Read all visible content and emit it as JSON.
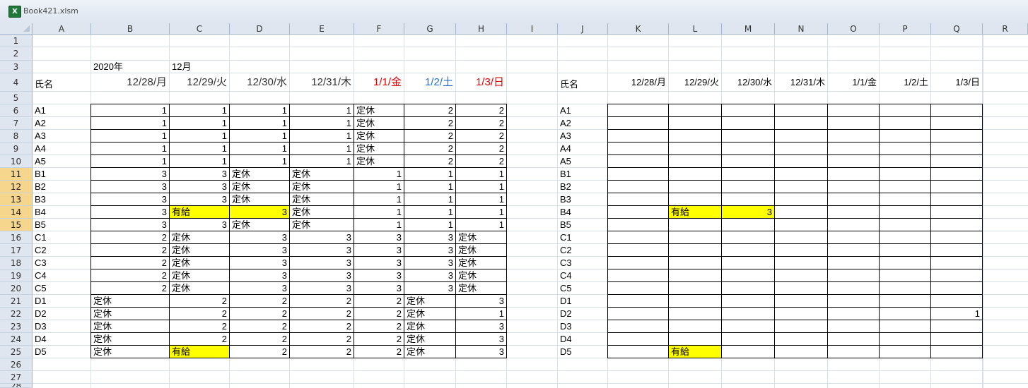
{
  "window": {
    "title": "Book421.xlsm",
    "icon": "excel-file-icon"
  },
  "columns": [
    "A",
    "B",
    "C",
    "D",
    "E",
    "F",
    "G",
    "H",
    "I",
    "J",
    "K",
    "L",
    "M",
    "N",
    "O",
    "P",
    "Q",
    "R"
  ],
  "rows": [
    "1",
    "2",
    "3",
    "4",
    "5",
    "6",
    "7",
    "8",
    "9",
    "10",
    "11",
    "12",
    "13",
    "14",
    "15",
    "16",
    "17",
    "18",
    "19",
    "20",
    "21",
    "22",
    "23",
    "24",
    "25",
    "26",
    "27",
    "28"
  ],
  "selected_row_headers": [
    "11",
    "12",
    "13",
    "14",
    "15"
  ],
  "header": {
    "year": "2020年",
    "month": "12月",
    "name_label": "氏名",
    "dates": [
      "12/28/月",
      "12/29/火",
      "12/30/水",
      "12/31/木",
      "1/1/金",
      "1/2/土",
      "1/3/日"
    ],
    "date_colors": [
      "#333333",
      "#333333",
      "#333333",
      "#333333",
      "#e00000",
      "#1e6fd0",
      "#e00000"
    ]
  },
  "left_table": [
    {
      "name": "A1",
      "cells": [
        "1",
        "1",
        "1",
        "1",
        "定休",
        "2",
        "2"
      ]
    },
    {
      "name": "A2",
      "cells": [
        "1",
        "1",
        "1",
        "1",
        "定休",
        "2",
        "2"
      ]
    },
    {
      "name": "A3",
      "cells": [
        "1",
        "1",
        "1",
        "1",
        "定休",
        "2",
        "2"
      ]
    },
    {
      "name": "A4",
      "cells": [
        "1",
        "1",
        "1",
        "1",
        "定休",
        "2",
        "2"
      ]
    },
    {
      "name": "A5",
      "cells": [
        "1",
        "1",
        "1",
        "1",
        "定休",
        "2",
        "2"
      ]
    },
    {
      "name": "B1",
      "cells": [
        "3",
        "3",
        "定休",
        "定休",
        "1",
        "1",
        "1"
      ]
    },
    {
      "name": "B2",
      "cells": [
        "3",
        "3",
        "定休",
        "定休",
        "1",
        "1",
        "1"
      ]
    },
    {
      "name": "B3",
      "cells": [
        "3",
        "3",
        "定休",
        "定休",
        "1",
        "1",
        "1"
      ]
    },
    {
      "name": "B4",
      "cells": [
        "3",
        "有給",
        "3",
        "定休",
        "1",
        "1",
        "1"
      ]
    },
    {
      "name": "B5",
      "cells": [
        "3",
        "3",
        "定休",
        "定休",
        "1",
        "1",
        "1"
      ]
    },
    {
      "name": "C1",
      "cells": [
        "2",
        "定休",
        "3",
        "3",
        "3",
        "3",
        "定休"
      ]
    },
    {
      "name": "C2",
      "cells": [
        "2",
        "定休",
        "3",
        "3",
        "3",
        "3",
        "定休"
      ]
    },
    {
      "name": "C3",
      "cells": [
        "2",
        "定休",
        "3",
        "3",
        "3",
        "3",
        "定休"
      ]
    },
    {
      "name": "C4",
      "cells": [
        "2",
        "定休",
        "3",
        "3",
        "3",
        "3",
        "定休"
      ]
    },
    {
      "name": "C5",
      "cells": [
        "2",
        "定休",
        "3",
        "3",
        "3",
        "3",
        "定休"
      ]
    },
    {
      "name": "D1",
      "cells": [
        "定休",
        "2",
        "2",
        "2",
        "2",
        "定休",
        "3"
      ]
    },
    {
      "name": "D2",
      "cells": [
        "定休",
        "2",
        "2",
        "2",
        "2",
        "定休",
        "1"
      ]
    },
    {
      "name": "D3",
      "cells": [
        "定休",
        "2",
        "2",
        "2",
        "2",
        "定休",
        "3"
      ]
    },
    {
      "name": "D4",
      "cells": [
        "定休",
        "2",
        "2",
        "2",
        "2",
        "定休",
        "3"
      ]
    },
    {
      "name": "D5",
      "cells": [
        "定休",
        "有給",
        "2",
        "2",
        "2",
        "定休",
        "3"
      ]
    }
  ],
  "left_highlights": [
    [
      8,
      1
    ],
    [
      8,
      2
    ],
    [
      19,
      1
    ]
  ],
  "right_table": [
    {
      "name": "A1",
      "cells": [
        "",
        "",
        "",
        "",
        "",
        "",
        ""
      ]
    },
    {
      "name": "A2",
      "cells": [
        "",
        "",
        "",
        "",
        "",
        "",
        ""
      ]
    },
    {
      "name": "A3",
      "cells": [
        "",
        "",
        "",
        "",
        "",
        "",
        ""
      ]
    },
    {
      "name": "A4",
      "cells": [
        "",
        "",
        "",
        "",
        "",
        "",
        ""
      ]
    },
    {
      "name": "A5",
      "cells": [
        "",
        "",
        "",
        "",
        "",
        "",
        ""
      ]
    },
    {
      "name": "B1",
      "cells": [
        "",
        "",
        "",
        "",
        "",
        "",
        ""
      ]
    },
    {
      "name": "B2",
      "cells": [
        "",
        "",
        "",
        "",
        "",
        "",
        ""
      ]
    },
    {
      "name": "B3",
      "cells": [
        "",
        "",
        "",
        "",
        "",
        "",
        ""
      ]
    },
    {
      "name": "B4",
      "cells": [
        "",
        "有給",
        "3",
        "",
        "",
        "",
        ""
      ]
    },
    {
      "name": "B5",
      "cells": [
        "",
        "",
        "",
        "",
        "",
        "",
        ""
      ]
    },
    {
      "name": "C1",
      "cells": [
        "",
        "",
        "",
        "",
        "",
        "",
        ""
      ]
    },
    {
      "name": "C2",
      "cells": [
        "",
        "",
        "",
        "",
        "",
        "",
        ""
      ]
    },
    {
      "name": "C3",
      "cells": [
        "",
        "",
        "",
        "",
        "",
        "",
        ""
      ]
    },
    {
      "name": "C4",
      "cells": [
        "",
        "",
        "",
        "",
        "",
        "",
        ""
      ]
    },
    {
      "name": "C5",
      "cells": [
        "",
        "",
        "",
        "",
        "",
        "",
        ""
      ]
    },
    {
      "name": "D1",
      "cells": [
        "",
        "",
        "",
        "",
        "",
        "",
        ""
      ]
    },
    {
      "name": "D2",
      "cells": [
        "",
        "",
        "",
        "",
        "",
        "",
        "1"
      ]
    },
    {
      "name": "D3",
      "cells": [
        "",
        "",
        "",
        "",
        "",
        "",
        ""
      ]
    },
    {
      "name": "D4",
      "cells": [
        "",
        "",
        "",
        "",
        "",
        "",
        ""
      ]
    },
    {
      "name": "D5",
      "cells": [
        "",
        "有給",
        "",
        "",
        "",
        "",
        ""
      ]
    }
  ],
  "right_highlights": [
    [
      8,
      1
    ],
    [
      8,
      2
    ],
    [
      19,
      1
    ]
  ],
  "highlight_color": "#ffff00"
}
